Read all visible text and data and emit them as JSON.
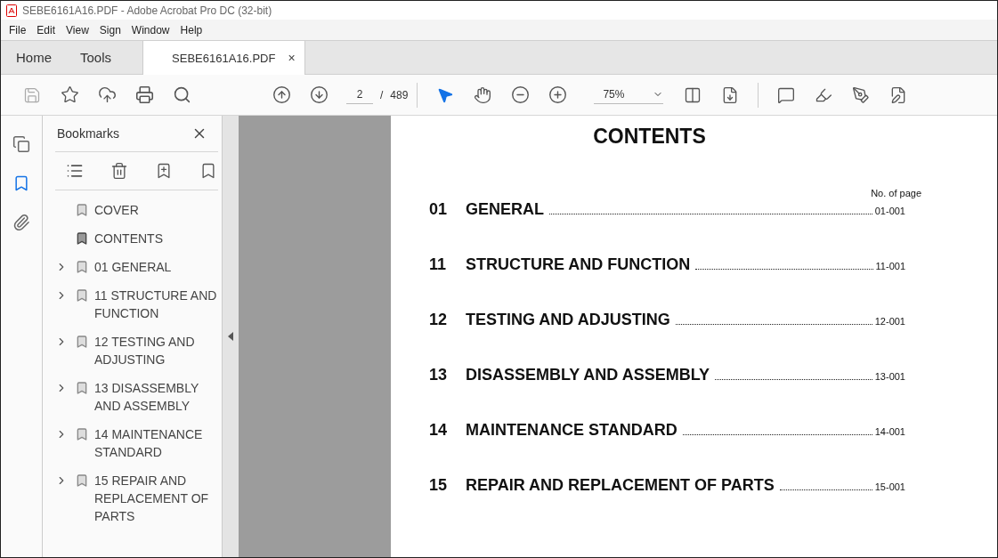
{
  "window": {
    "title": "SEBE6161A16.PDF - Adobe Acrobat Pro DC (32-bit)"
  },
  "menu": [
    "File",
    "Edit",
    "View",
    "Sign",
    "Window",
    "Help"
  ],
  "tabs": [
    {
      "label": "Home",
      "selected": false,
      "kind": "nav"
    },
    {
      "label": "Tools",
      "selected": false,
      "kind": "nav"
    },
    {
      "label": "SEBE6161A16.PDF",
      "selected": true,
      "kind": "document",
      "close": "×"
    }
  ],
  "toolbar": {
    "page_field": "2",
    "page_separator": "/",
    "page_total": "489",
    "zoom": "75%",
    "tools": [
      {
        "kind": "select",
        "selected": true
      },
      {
        "kind": "hand",
        "selected": false
      }
    ]
  },
  "rail": [
    {
      "kind": "pages",
      "selected": false
    },
    {
      "kind": "bookmarks",
      "selected": true
    },
    {
      "kind": "attachments",
      "selected": false
    }
  ],
  "bookmarks": {
    "title": "Bookmarks",
    "items": [
      {
        "label": "COVER",
        "expandable": false,
        "current": false
      },
      {
        "label": "CONTENTS",
        "expandable": false,
        "current": true
      },
      {
        "label": "01 GENERAL",
        "expandable": true,
        "current": false
      },
      {
        "label": "11 STRUCTURE AND FUNCTION",
        "expandable": true,
        "current": false
      },
      {
        "label": "12 TESTING AND ADJUSTING",
        "expandable": true,
        "current": false
      },
      {
        "label": "13 DISASSEMBLY AND ASSEMBLY",
        "expandable": true,
        "current": false
      },
      {
        "label": "14 MAINTENANCE STANDARD",
        "expandable": true,
        "current": false
      },
      {
        "label": "15 REPAIR AND REPLACEMENT OF PARTS",
        "expandable": true,
        "current": false
      }
    ]
  },
  "document": {
    "title": "CONTENTS",
    "column_header": "No. of page",
    "entries": [
      {
        "number": "01",
        "title": "GENERAL",
        "page": "01-001"
      },
      {
        "number": "11",
        "title": "STRUCTURE AND FUNCTION",
        "page": "11-001"
      },
      {
        "number": "12",
        "title": "TESTING AND ADJUSTING",
        "page": "12-001"
      },
      {
        "number": "13",
        "title": "DISASSEMBLY AND ASSEMBLY",
        "page": "13-001"
      },
      {
        "number": "14",
        "title": "MAINTENANCE STANDARD",
        "page": "14-001"
      },
      {
        "number": "15",
        "title": "REPAIR AND REPLACEMENT OF PARTS",
        "page": "15-001"
      }
    ]
  }
}
